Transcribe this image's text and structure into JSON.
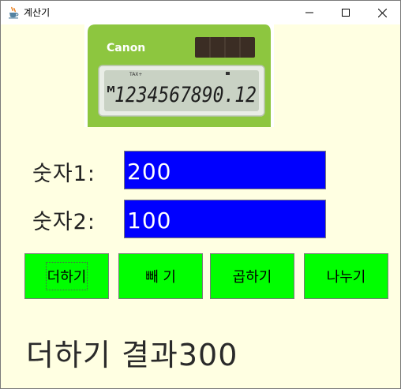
{
  "window": {
    "title": "계산기",
    "icon": "java-cup-icon"
  },
  "title_controls": {
    "minimize_icon": "minimize-icon",
    "maximize_icon": "maximize-icon",
    "close_icon": "close-icon"
  },
  "calculator_image": {
    "brand": "Canon",
    "small_label": "TAX+",
    "memory_indicator": "M",
    "display_digits": "1234567890.12"
  },
  "form": {
    "label1": "숫자1:",
    "value1": "200",
    "label2": "숫자2:",
    "value2": "100"
  },
  "buttons": {
    "add": "더하기",
    "subtract": "빼 기",
    "multiply": "곱하기",
    "divide": "나누기"
  },
  "result": {
    "text": "더하기 결과300"
  },
  "colors": {
    "window_background": "#ffffe2",
    "field_background": "#0000ff",
    "field_text": "#ffffff",
    "button_background": "#00ff00",
    "calculator_body": "#8dc63f"
  }
}
